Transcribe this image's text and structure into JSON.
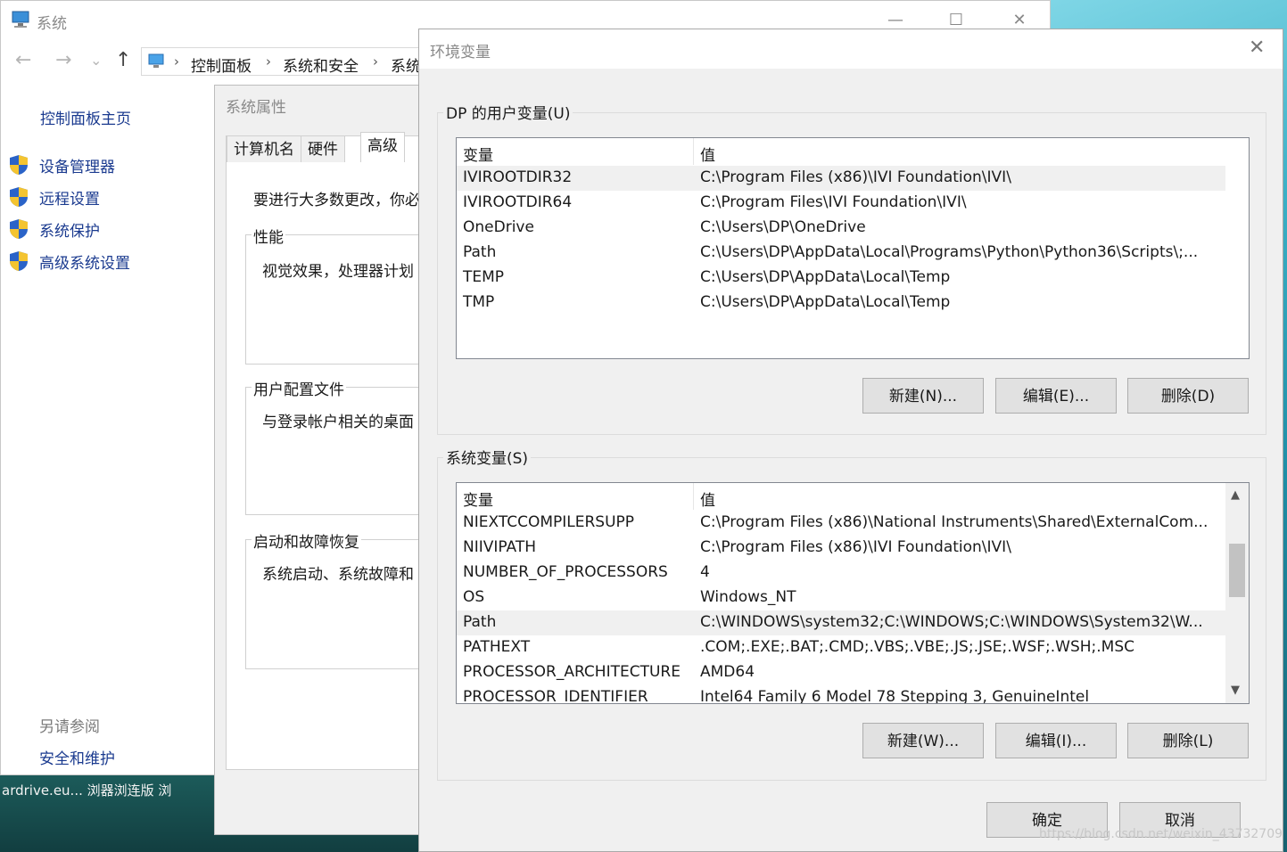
{
  "taskbar": {
    "text": "ardrive.eu...   浏器浏连版   浏"
  },
  "system_window": {
    "title": "系统",
    "controls": {
      "minimize": "—",
      "maximize": "☐",
      "close": "✕"
    },
    "nav": {
      "back": "←",
      "forward": "→",
      "dropdown": "⌄",
      "up": "↑"
    },
    "breadcrumb": [
      "控制面板",
      "系统和安全",
      "系统"
    ],
    "sidebar": {
      "home": "控制面板主页",
      "items": [
        "设备管理器",
        "远程设置",
        "系统保护",
        "高级系统设置"
      ],
      "see_also": "另请参阅",
      "security": "安全和维护"
    }
  },
  "system_properties": {
    "title": "系统属性",
    "tabs": [
      "计算机名",
      "硬件",
      "高级"
    ],
    "intro": "要进行大多数更改，你必",
    "groups": [
      {
        "title": "性能",
        "text": "视觉效果，处理器计划"
      },
      {
        "title": "用户配置文件",
        "text": "与登录帐户相关的桌面"
      },
      {
        "title": "启动和故障恢复",
        "text": "系统启动、系统故障和"
      }
    ]
  },
  "env_dialog": {
    "title": "环境变量",
    "close": "✕",
    "user_vars": {
      "title": "DP 的用户变量(U)",
      "col_name": "变量",
      "col_value": "值",
      "rows": [
        {
          "name": "IVIROOTDIR32",
          "value": "C:\\Program Files (x86)\\IVI Foundation\\IVI\\"
        },
        {
          "name": "IVIROOTDIR64",
          "value": "C:\\Program Files\\IVI Foundation\\IVI\\"
        },
        {
          "name": "OneDrive",
          "value": "C:\\Users\\DP\\OneDrive"
        },
        {
          "name": "Path",
          "value": "C:\\Users\\DP\\AppData\\Local\\Programs\\Python\\Python36\\Scripts\\;..."
        },
        {
          "name": "TEMP",
          "value": "C:\\Users\\DP\\AppData\\Local\\Temp"
        },
        {
          "name": "TMP",
          "value": "C:\\Users\\DP\\AppData\\Local\\Temp"
        }
      ],
      "buttons": {
        "new": "新建(N)...",
        "edit": "编辑(E)...",
        "delete": "删除(D)"
      }
    },
    "system_vars": {
      "title": "系统变量(S)",
      "col_name": "变量",
      "col_value": "值",
      "rows": [
        {
          "name": "NIEXTCCOMPILERSUPP",
          "value": "C:\\Program Files (x86)\\National Instruments\\Shared\\ExternalCom..."
        },
        {
          "name": "NIIVIPATH",
          "value": "C:\\Program Files (x86)\\IVI Foundation\\IVI\\"
        },
        {
          "name": "NUMBER_OF_PROCESSORS",
          "value": "4"
        },
        {
          "name": "OS",
          "value": "Windows_NT"
        },
        {
          "name": "Path",
          "value": "C:\\WINDOWS\\system32;C:\\WINDOWS;C:\\WINDOWS\\System32\\W..."
        },
        {
          "name": "PATHEXT",
          "value": ".COM;.EXE;.BAT;.CMD;.VBS;.VBE;.JS;.JSE;.WSF;.WSH;.MSC"
        },
        {
          "name": "PROCESSOR_ARCHITECTURE",
          "value": "AMD64"
        },
        {
          "name": "PROCESSOR_IDENTIFIER",
          "value": "Intel64 Family 6 Model 78 Stepping 3, GenuineIntel"
        }
      ],
      "buttons": {
        "new": "新建(W)...",
        "edit": "编辑(I)...",
        "delete": "删除(L)"
      },
      "scroll": {
        "up": "▲",
        "down": "▼"
      }
    },
    "ok": "确定",
    "cancel": "取消"
  },
  "watermark": "https://blog.csdn.net/weixin_43732709"
}
